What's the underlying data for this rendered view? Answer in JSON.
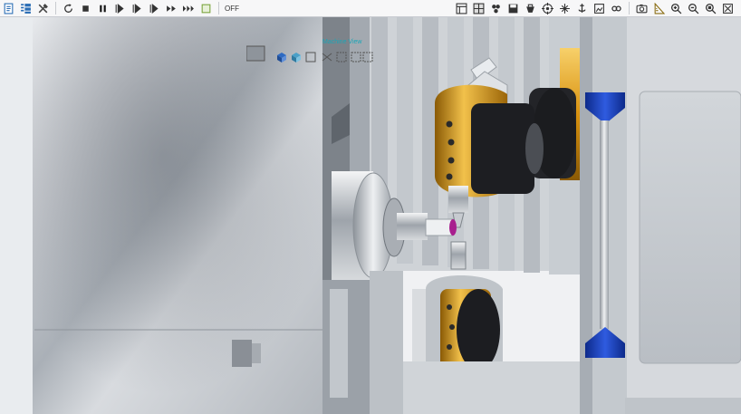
{
  "toolbar": {
    "left_icons": [
      "document-icon",
      "list-stack-icon",
      "tools-icon"
    ],
    "playback_icons": [
      "reset-icon",
      "stop-icon",
      "pause-icon",
      "step-1-icon",
      "step-2-icon",
      "step-3-icon",
      "fast-forward-icon",
      "skip-forward-icon",
      "highlight-icon"
    ],
    "speed_label": "OFF",
    "view_icons": [
      "layout-icon",
      "grid-icon",
      "cluster-icon",
      "save-icon",
      "clip-icon",
      "target-icon",
      "rotate-icon",
      "anchor-icon",
      "frame-icon",
      "link-icon"
    ],
    "right_icons": [
      "camera-icon",
      "measure-icon",
      "zoom-in-icon",
      "zoom-out-icon",
      "zoom-fit-icon",
      "fit-window-icon"
    ]
  },
  "viewport": {
    "view_label": "Machine View",
    "colors": {
      "chuck_gold": "#e3a21a",
      "spindle_black": "#1d1e22",
      "accent_blue": "#1a3fb8",
      "panel_gray": "#c7cbd0",
      "background": "#f1f2f4"
    }
  }
}
